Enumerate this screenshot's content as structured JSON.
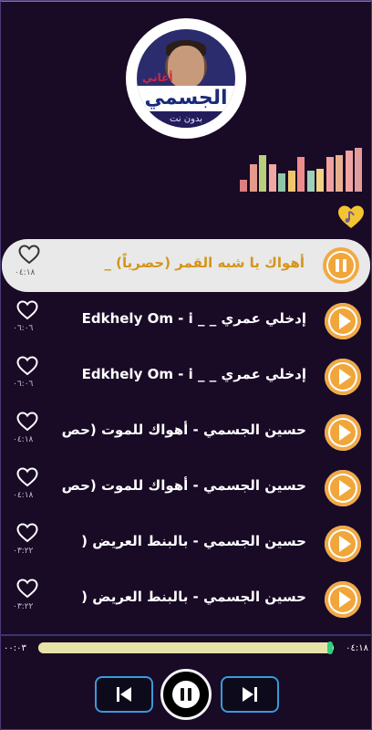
{
  "album": {
    "caption": "أغاني",
    "name": "الجسمي",
    "subtitle": "بدون نت"
  },
  "colors": {
    "background": "#190a26",
    "accent": "#f0a63a",
    "active_title": "#d4951b",
    "progress_knob": "#2fd07c",
    "control_border": "#3b9ad9"
  },
  "equalizer": {
    "levels": [
      0.25,
      0.6,
      0.8,
      0.6,
      0.4,
      0.45,
      0.75,
      0.45,
      0.5,
      0.75,
      0.8,
      0.9,
      0.95
    ],
    "colors": [
      "#d97f7f",
      "#e59b8c",
      "#b9cf7d",
      "#f2a7a7",
      "#8fc6a8",
      "#f1c56f",
      "#f08b8b",
      "#9fd0b9",
      "#f1d286",
      "#f2a0a0",
      "#e8b08e",
      "#f2a3a3",
      "#e29c9c"
    ]
  },
  "songs": [
    {
      "title": "أهواك يا شبه القمر (حصرياً) _",
      "duration": "٠٤:١٨",
      "active": true
    },
    {
      "title": "إدخلي عمري _ _ Edkhely Om - i",
      "duration": "٠٦:٠٦",
      "active": false
    },
    {
      "title": "إدخلي عمري _ _ Edkhely Om - i",
      "duration": "٠٦:٠٦",
      "active": false
    },
    {
      "title": "حسين الجسمي - أهواك للموت (حص",
      "duration": "٠٤:١٨",
      "active": false
    },
    {
      "title": "حسين الجسمي - أهواك للموت (حص",
      "duration": "٠٤:١٨",
      "active": false
    },
    {
      "title": "حسين الجسمي - بالبنط العريض (",
      "duration": "٠٣:٢٢",
      "active": false
    },
    {
      "title": "حسين الجسمي - بالبنط العريض (",
      "duration": "٠٣:٢٢",
      "active": false
    }
  ],
  "player": {
    "elapsed": "٠٠:٠٣",
    "total": "٠٤:١٨",
    "progress": 0.99
  }
}
